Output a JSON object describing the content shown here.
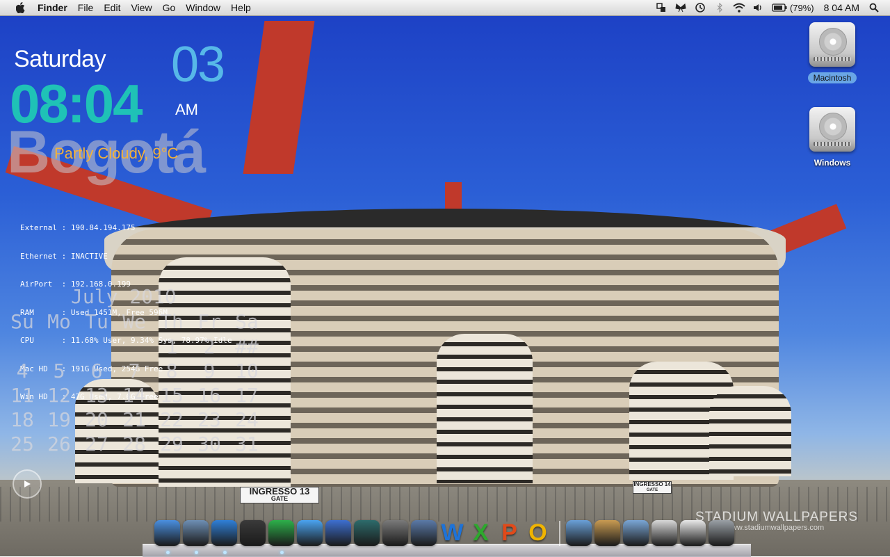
{
  "menubar": {
    "app_name": "Finder",
    "menus": [
      "File",
      "Edit",
      "View",
      "Go",
      "Window",
      "Help"
    ],
    "battery_percent": "(79%)",
    "clock": "8 04 AM",
    "status_icons": [
      "spaces-icon",
      "butterfly-icon",
      "time-machine-icon",
      "bluetooth-icon",
      "wifi-icon",
      "volume-icon",
      "battery-icon"
    ]
  },
  "widgets": {
    "day": "Saturday",
    "time": "08:04",
    "date": "03",
    "ampm": "AM",
    "city": "Bogotá",
    "weather": "Partly Cloudy, 9°C"
  },
  "sysinfo": [
    "External : 190.84.194.175",
    "Ethernet : INACTIVE",
    "AirPort  : 192.168.0.199",
    "RAM      : Used 1451M, Free 596M",
    "CPU      : 11.68% User, 9.34% Sys, 78.97% Idle",
    "Mac HD   : 191G Used, 254G Free",
    "Win HD   : 47G Used, 7.6G Free"
  ],
  "calendar": {
    "title": "July 2010",
    "weekdays": [
      "Su",
      "Mo",
      "Tu",
      "We",
      "Th",
      "Fr",
      "Sa"
    ],
    "weeks": [
      [
        "",
        "",
        "",
        "",
        "1",
        "2",
        "##"
      ],
      [
        "4",
        "5",
        "6",
        "7",
        "8",
        "9",
        "10"
      ],
      [
        "11",
        "12",
        "13",
        "14",
        "15",
        "16",
        "17"
      ],
      [
        "18",
        "19",
        "20",
        "21",
        "22",
        "23",
        "24"
      ],
      [
        "25",
        "26",
        "27",
        "28",
        "29",
        "30",
        "31"
      ]
    ]
  },
  "desktop_icons": [
    {
      "label": "Macintosh",
      "selected": true
    },
    {
      "label": "Windows",
      "selected": false
    }
  ],
  "wallpaper": {
    "gate_left": "INGRESSO 13",
    "gate_left_sub": "GATE",
    "gate_right": "INGRESSO 14",
    "gate_right_sub": "GATE",
    "watermark": "STADIUM WALLPAPERS",
    "watermark_url": "www.stadiumwallpapers.com"
  },
  "dock": {
    "apps": [
      {
        "name": "finder",
        "color": "#4a8fe0",
        "running": true
      },
      {
        "name": "mail-stamp",
        "color": "#6e8fb5",
        "running": true
      },
      {
        "name": "safari",
        "color": "#2f7fd8",
        "running": true
      },
      {
        "name": "adium",
        "color": "#3a3a3a",
        "running": false
      },
      {
        "name": "messenger",
        "color": "#2db04a",
        "running": true
      },
      {
        "name": "ichat",
        "color": "#4aa3f0",
        "running": false
      },
      {
        "name": "itunes",
        "color": "#3d6fd0",
        "running": false
      },
      {
        "name": "time-machine",
        "color": "#2d6b6b",
        "running": false
      },
      {
        "name": "system-preferences",
        "color": "#7a7a7a",
        "running": false
      },
      {
        "name": "remote-desktop",
        "color": "#5b7aa8",
        "running": false
      },
      {
        "name": "word",
        "color": "#1e73d8",
        "letter": "W",
        "running": false
      },
      {
        "name": "excel",
        "color": "#2ea82e",
        "letter": "X",
        "running": false
      },
      {
        "name": "powerpoint",
        "color": "#e04a1a",
        "letter": "P",
        "running": false
      },
      {
        "name": "outlook",
        "color": "#f0b400",
        "letter": "O",
        "running": false
      }
    ],
    "folders": [
      {
        "name": "applications-folder",
        "color": "#6aa0d8"
      },
      {
        "name": "documents-folder",
        "color": "#c99b52"
      },
      {
        "name": "downloads-folder",
        "color": "#7aa6d6"
      },
      {
        "name": "mail-preview",
        "color": "#d8d8d8"
      },
      {
        "name": "document-stack",
        "color": "#e8e8e8"
      },
      {
        "name": "trash",
        "color": "#9aa0a6"
      }
    ]
  }
}
